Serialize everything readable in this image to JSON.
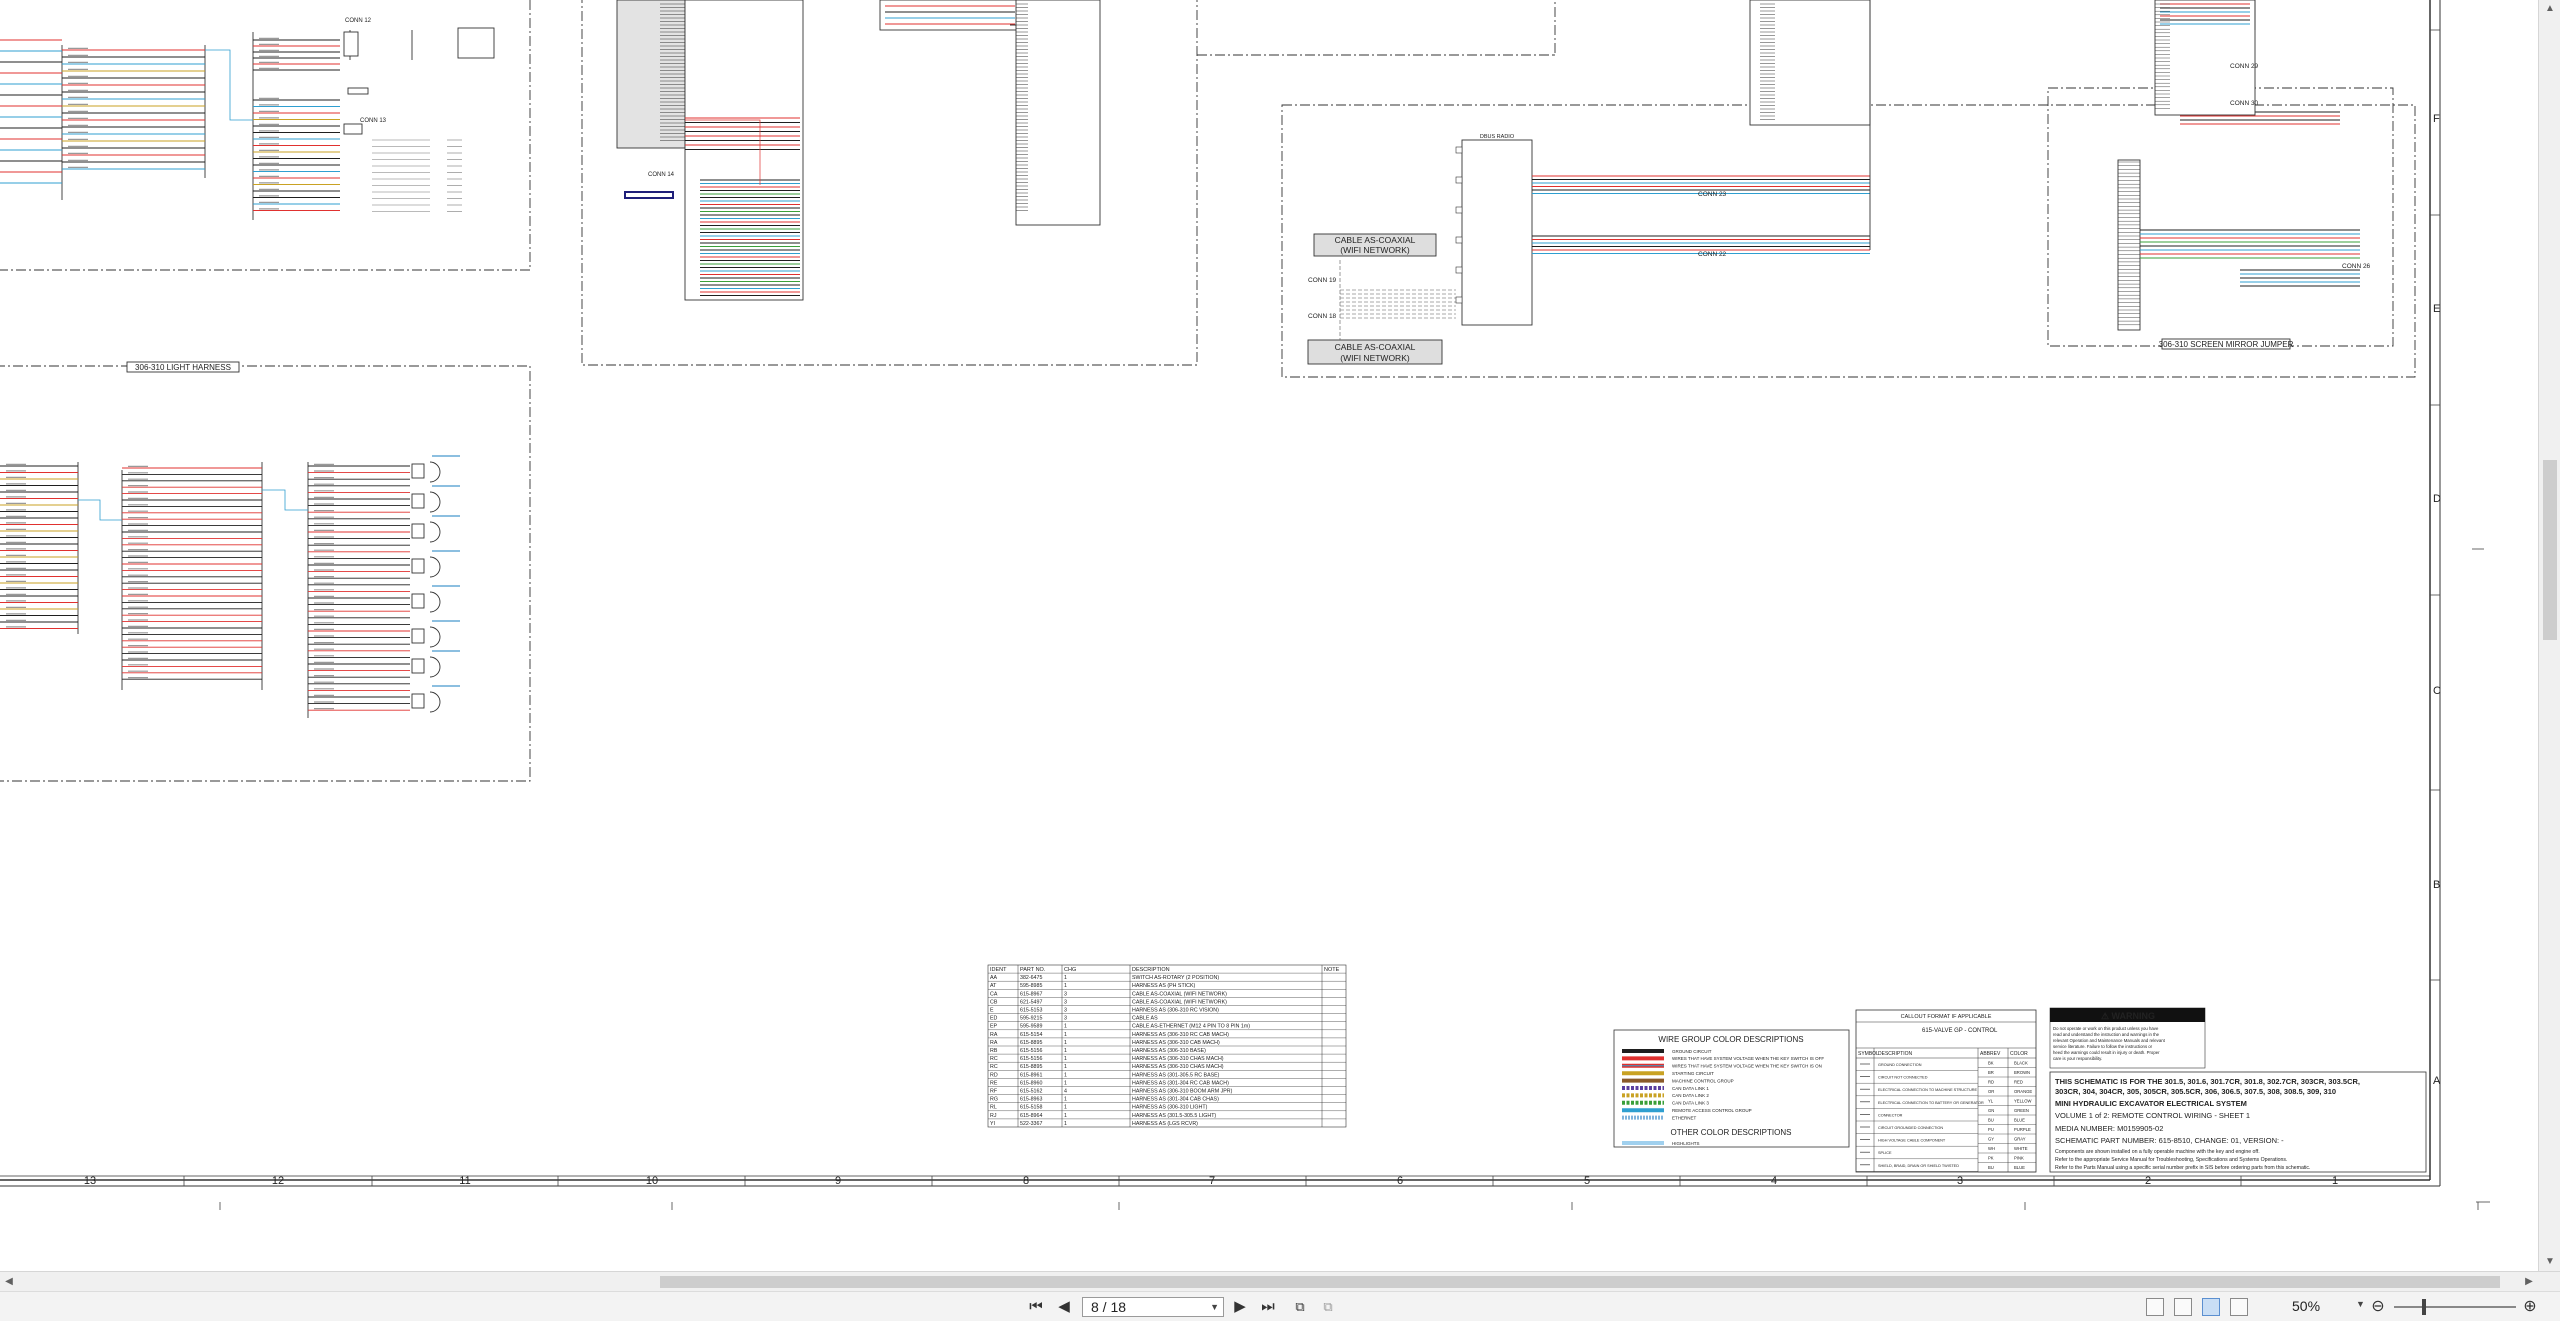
{
  "viewer": {
    "app": "PDF viewer"
  },
  "schematic": {
    "harness_labels": {
      "light_harness": "306-310 LIGHT HARNESS",
      "screen_mirror": "306-310 SCREEN MIRROR JUMPER",
      "coax_top": [
        "CABLE AS-COAXIAL",
        "(WIFI NETWORK)"
      ],
      "coax_bottom": [
        "CABLE AS-COAXIAL",
        "(WIFI NETWORK)"
      ]
    },
    "conn_labels": [
      "CONN 12",
      "CONN 13",
      "CONN 19",
      "CONN 23",
      "CONN 22",
      "CONN 28",
      "CONN 29",
      "CONN 30",
      "CONN 31",
      "CONN 26",
      "CONN 27"
    ],
    "radio_label": "DBUS RADIO",
    "column_numbers": [
      "13",
      "12",
      "11",
      "10",
      "9",
      "8",
      "7",
      "6",
      "5",
      "4",
      "3",
      "2",
      "1"
    ],
    "row_letters": [
      "F",
      "E",
      "D",
      "C",
      "B",
      "A"
    ],
    "parts_table": {
      "headers": [
        "IDENT",
        "PART NO.",
        "CHG",
        "DESCRIPTION",
        "NOTE"
      ],
      "rows": [
        [
          "AA",
          "382-6475",
          "1",
          "SWITCH AS-ROTARY (2 POSITION)",
          ""
        ],
        [
          "AT",
          "595-8985",
          "1",
          "HARNESS AS (PH STICK)",
          ""
        ],
        [
          "CA",
          "615-8967",
          "3",
          "CABLE AS-COAXIAL (WIFI NETWORK)",
          ""
        ],
        [
          "CB",
          "621-5497",
          "3",
          "CABLE AS-COAXIAL (WIFI NETWORK)",
          ""
        ],
        [
          "E",
          "615-5153",
          "3",
          "HARNESS AS (306-310 RC VISION)",
          ""
        ],
        [
          "ED",
          "595-9215",
          "3",
          "CABLE AS",
          ""
        ],
        [
          "EP",
          "595-9589",
          "1",
          "CABLE AS-ETHERNET (M12 4 PIN TO 8 PIN 1m)",
          ""
        ],
        [
          "RA",
          "615-5154",
          "1",
          "HARNESS AS (306-310 RC CAB MACH)",
          ""
        ],
        [
          "RA",
          "615-8895",
          "1",
          "HARNESS AS (306-310 CAB MACH)",
          ""
        ],
        [
          "RB",
          "615-5156",
          "1",
          "HARNESS AS (306-310 BASE)",
          ""
        ],
        [
          "RC",
          "615-5156",
          "1",
          "HARNESS AS (306-310 CHAS MACH)",
          ""
        ],
        [
          "RC",
          "615-8895",
          "1",
          "HARNESS AS (306-310 CHAS MACH)",
          ""
        ],
        [
          "RD",
          "615-8961",
          "1",
          "HARNESS AS (301-305.5 RC BASE)",
          ""
        ],
        [
          "RE",
          "615-8960",
          "1",
          "HARNESS AS (301-304 RC CAB MACH)",
          ""
        ],
        [
          "RF",
          "615-5162",
          "4",
          "HARNESS AS (306-310 BOOM ARM JPR)",
          ""
        ],
        [
          "RG",
          "615-8963",
          "1",
          "HARNESS AS (301-304 CAB CHAS)",
          ""
        ],
        [
          "RL",
          "615-5158",
          "1",
          "HARNESS AS (306-310 LIGHT)",
          ""
        ],
        [
          "RJ",
          "615-8964",
          "1",
          "HARNESS AS (301.5-305.5 LIGHT)",
          ""
        ],
        [
          "YI",
          "522-3367",
          "1",
          "HARNESS AS (LGS RCVR)",
          ""
        ]
      ]
    },
    "wire_group": {
      "title": "WIRE GROUP COLOR DESCRIPTIONS",
      "items": [
        "GROUND CIRCUIT",
        "WIRES THAT HAVE SYSTEM VOLTAGE WHEN THE KEY SWITCH IS OFF",
        "WIRES THAT HAVE SYSTEM VOLTAGE WHEN THE KEY SWITCH IS ON",
        "STARTING CIRCUIT",
        "MACHINE CONTROL GROUP",
        "CAN DATA LINK 1",
        "CAN DATA LINK 2",
        "CAN DATA LINK 3",
        "REMOTE ACCESS CONTROL GROUP",
        "ETHERNET"
      ],
      "other_title": "OTHER COLOR DESCRIPTIONS",
      "other_items": [
        "HIGHLIGHTS"
      ]
    },
    "callout": {
      "title": "CALLOUT FORMAT IF APPLICABLE",
      "example": "615-VALVE GP - CONTROL",
      "symbol_headers": [
        "SYMBOL",
        "DESCRIPTION"
      ],
      "symbols": [
        "GROUND CONNECTION",
        "CIRCUIT NOT CONNECTED",
        "ELECTRICAL CONNECTION TO MACHINE STRUCTURE",
        "ELECTRICAL CONNECTION TO BATTERY OR GENERATOR",
        "CONNECTOR",
        "CIRCUIT GROUNDED CONNECTION",
        "HIGH VOLTAGE CABLE COMPONENT",
        "SPLICE",
        "SHIELD, BRAID, DRAIN OR SHIELD TWISTED"
      ],
      "color_headers": [
        "ABBREV",
        "COLOR"
      ],
      "colors": [
        [
          "BK",
          "BLACK"
        ],
        [
          "BR",
          "BROWN"
        ],
        [
          "RD",
          "RED"
        ],
        [
          "OR",
          "ORANGE"
        ],
        [
          "YL",
          "YELLOW"
        ],
        [
          "GN",
          "GREEN"
        ],
        [
          "BU",
          "BLUE"
        ],
        [
          "PU",
          "PURPLE"
        ],
        [
          "GY",
          "GRAY"
        ],
        [
          "WH",
          "WHITE"
        ],
        [
          "PK",
          "PINK"
        ],
        [
          "BU",
          "BLUE"
        ]
      ]
    },
    "warning": {
      "title": "WARNING",
      "body": "Do not operate or work on this product unless you have read and understand the instruction and warnings in the relevant Operation and Maintenance Manuals and relevant service literature. Failure to follow the instructions or heed the warnings could result in injury or death. Proper care is your responsibility."
    },
    "title_block": {
      "line1": "THIS SCHEMATIC IS FOR THE 301.5, 301.6, 301.7CR, 301.8, 302.7CR, 303CR, 303.5CR,",
      "line2": "303CR, 304, 304CR, 305, 305CR, 305.5CR, 306, 306.5, 307.5, 308, 308.5, 309, 310",
      "line3": "MINI HYDRAULIC EXCAVATOR ELECTRICAL SYSTEM",
      "line4": "VOLUME 1 of 2: REMOTE CONTROL WIRING - SHEET 1",
      "media": "MEDIA NUMBER: M0159905-02",
      "part": "SCHEMATIC PART NUMBER: 615-8510, CHANGE: 01, VERSION: -",
      "note1": "Components are shown installed on a fully operable machine with the key and engine off.",
      "note2": "Refer to the appropriate Service Manual for Troubleshooting, Specifications and Systems Operations.",
      "note3": "Refer to the Parts Manual using a specific serial number prefix in SIS before ordering parts from this schematic."
    }
  },
  "toolbar": {
    "page_value": "8 / 18",
    "zoom_value": "50%"
  }
}
